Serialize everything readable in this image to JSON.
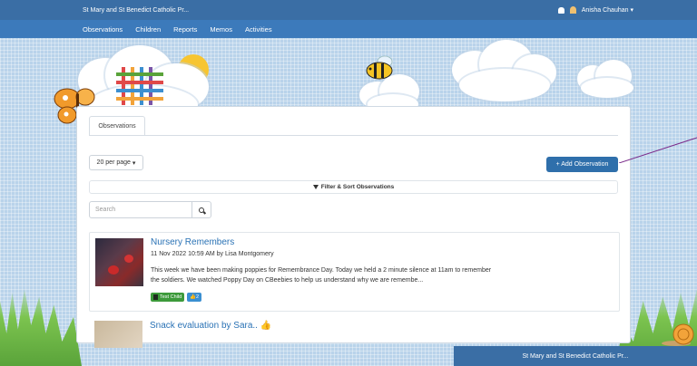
{
  "topbar": {
    "school_name": "St Mary and St Benedict Catholic Pr...",
    "user_name": "Anisha Chauhan",
    "user_caret": "▾"
  },
  "nav": {
    "items": [
      "Observations",
      "Children",
      "Reports",
      "Memos",
      "Activities"
    ]
  },
  "panel": {
    "tab_label": "Observations",
    "per_page_label": "20 per page",
    "per_page_caret": "▾",
    "add_button_label": "+ Add Observation",
    "filter_label": "Filter & Sort Observations",
    "search_placeholder": "Search"
  },
  "observations": [
    {
      "title": "Nursery Remembers",
      "meta": "11 Nov 2022 10:59 AM by Lisa Montgomery",
      "text": "This week we have been making poppies for Remembrance Day. Today we held a 2 minute silence at 11am to remember the soldiers. We watched Poppy Day on CBeebies to help us understand why we are remembe...",
      "child_chip": "Test Child",
      "like_chip": "👍2"
    },
    {
      "title": "Snack evaluation by Sara.. 👍"
    }
  ],
  "footer": {
    "school_name": "St Mary and St Benedict Catholic Pr..."
  },
  "colors": {
    "topbar": "#3a6ea5",
    "navbar": "#3c7abb",
    "accent_button": "#2f6fab",
    "link": "#2a72b5",
    "child_chip": "#3d9a3b",
    "like_chip": "#3b8fd1"
  }
}
